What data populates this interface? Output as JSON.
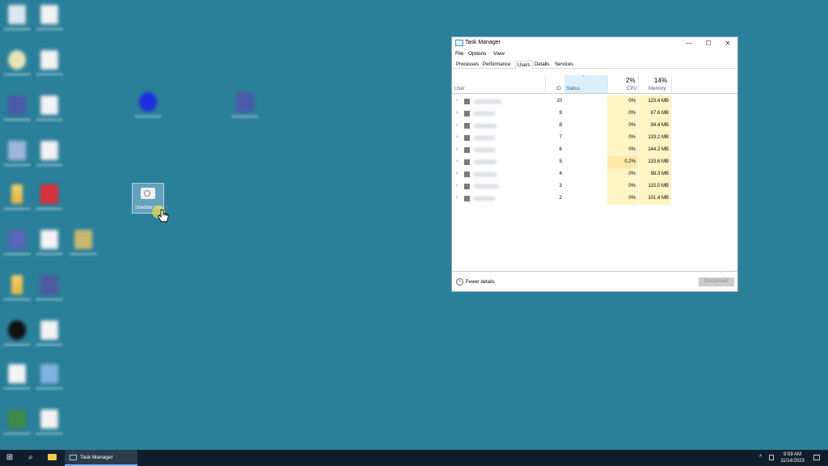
{
  "desktop": {
    "shortcut": {
      "label": "Shadow Rdp"
    }
  },
  "window": {
    "title": "Task Manager",
    "controls": {
      "minimize": "—",
      "maximize": "☐",
      "close": "✕"
    },
    "menu": [
      "File",
      "Options",
      "View"
    ],
    "tabs": [
      "Processes",
      "Performance",
      "Users",
      "Details",
      "Services"
    ],
    "active_tab": "Users",
    "headers": {
      "user": "User",
      "id": "ID",
      "status": "Status",
      "cpu_total": "2%",
      "cpu": "CPU",
      "memory_total": "14%",
      "memory": "Memory",
      "sort_arrow": "ˇ"
    },
    "rows": [
      {
        "id": "10",
        "cpu": "0%",
        "memory": "123.4 MB"
      },
      {
        "id": "9",
        "cpu": "0%",
        "memory": "87.6 MB"
      },
      {
        "id": "8",
        "cpu": "0%",
        "memory": "94.4 MB"
      },
      {
        "id": "7",
        "cpu": "0%",
        "memory": "133.2 MB"
      },
      {
        "id": "6",
        "cpu": "0%",
        "memory": "144.2 MB"
      },
      {
        "id": "5",
        "cpu": "0.2%",
        "memory": "133.6 MB"
      },
      {
        "id": "4",
        "cpu": "0%",
        "memory": "98.3 MB"
      },
      {
        "id": "3",
        "cpu": "0%",
        "memory": "115.0 MB"
      },
      {
        "id": "2",
        "cpu": "0%",
        "memory": "101.4 MB"
      }
    ],
    "footer": {
      "fewer_details": "Fewer details",
      "disconnect": "Disconnect"
    }
  },
  "taskbar": {
    "start": "⊞",
    "search": "⌕",
    "task_label": "Task Manager",
    "tray_chevron": "^",
    "time": "9:59 AM",
    "date": "11/14/2023"
  },
  "colors": {
    "desktop": "#2a7f9a",
    "taskbar": "#0f1e2a",
    "cpu_cell": "#fff4c4",
    "status_header": "#dbeefb"
  }
}
